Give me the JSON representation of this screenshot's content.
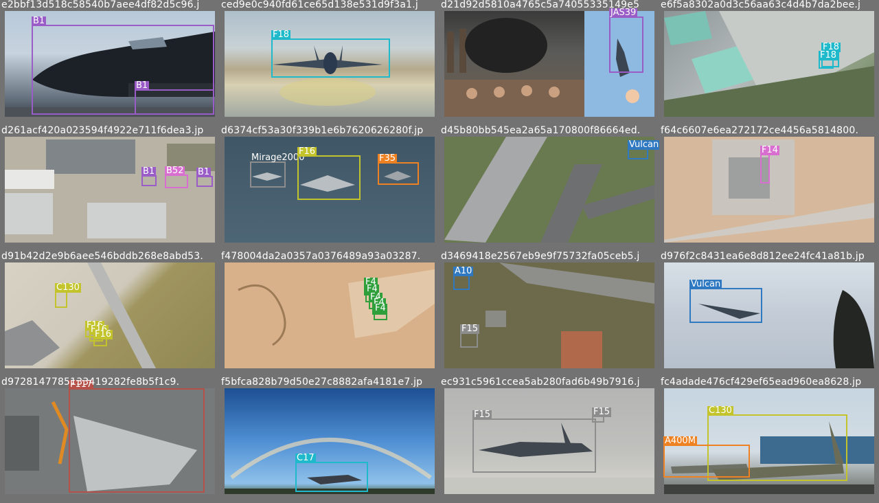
{
  "tiles": [
    {
      "filename": "e2bbf13d518c58540b7aee4df82d5c96.j",
      "labels": [
        "B1",
        "B1"
      ]
    },
    {
      "filename": "ced9e0c940fd61ce65d138e531d9f3a1.j",
      "labels": [
        "F18"
      ]
    },
    {
      "filename": "d21d92d5810a4765c5a74055335149e5",
      "labels": [
        "JAS39"
      ]
    },
    {
      "filename": "e6f5a8302a0d3c56aa63c4d4b7da2bee.j",
      "labels": [
        "F18",
        "F18"
      ]
    },
    {
      "filename": "d261acf420a023594f4922e711f6dea3.jp",
      "labels": [
        "B1",
        "B52",
        "B1"
      ]
    },
    {
      "filename": "d6374cf53a30f339b1e6b7620626280f.jp",
      "labels": [
        "Mirage2000",
        "F16",
        "F35"
      ]
    },
    {
      "filename": "d45b80bb545ea2a65a170800f86664ed.",
      "labels": [
        "Vulcan"
      ]
    },
    {
      "filename": "f64c6607e6ea272172ce4456a5814800.",
      "labels": [
        "F14"
      ]
    },
    {
      "filename": "d91b42d2e9b6aee546bddb268e8abd53.",
      "labels": [
        "C130",
        "F16",
        "F16",
        "F16"
      ]
    },
    {
      "filename": "f478004da2a0357a0376489a93a03287.",
      "labels": [
        "F4",
        "F4",
        "F4",
        "F4",
        "F4"
      ]
    },
    {
      "filename": "d3469418e2567eb9e9f75732fa05ceb5.j",
      "labels": [
        "A10",
        "F15"
      ]
    },
    {
      "filename": "d976f2c8431ea6e8d812ee24fc41a81b.jp",
      "labels": [
        "Vulcan"
      ]
    },
    {
      "filename": "d9728147785133419282fe8b5f1c9.",
      "labels": [
        "F117"
      ]
    },
    {
      "filename": "f5bfca828b79d50e27c8882afa4181e7.jp",
      "labels": [
        "C17"
      ]
    },
    {
      "filename": "ec931c5961ccea5ab280fad6b49b7916.j",
      "labels": [
        "F15",
        "F15"
      ]
    },
    {
      "filename": "fc4adade476cf429ef65ead960ea8628.jp",
      "labels": [
        "C130",
        "A400M"
      ]
    }
  ],
  "colors": {
    "B1": "#9a5cc7",
    "F18": "#1fb9cc",
    "JAS39": "#9a5cc7",
    "B52": "#d86ecf",
    "Mirage2000": "#8d8d8d",
    "F16": "#c3c42b",
    "F35": "#ee8122",
    "Vulcan": "#2e79c2",
    "F14": "#d86ecf",
    "C130": "#c3c42b",
    "F4": "#2f9f3c",
    "A10": "#2e79c2",
    "F15": "#8d8d8d",
    "F117": "#b65149",
    "C17": "#1fb9cc",
    "A400M": "#ee8122"
  }
}
